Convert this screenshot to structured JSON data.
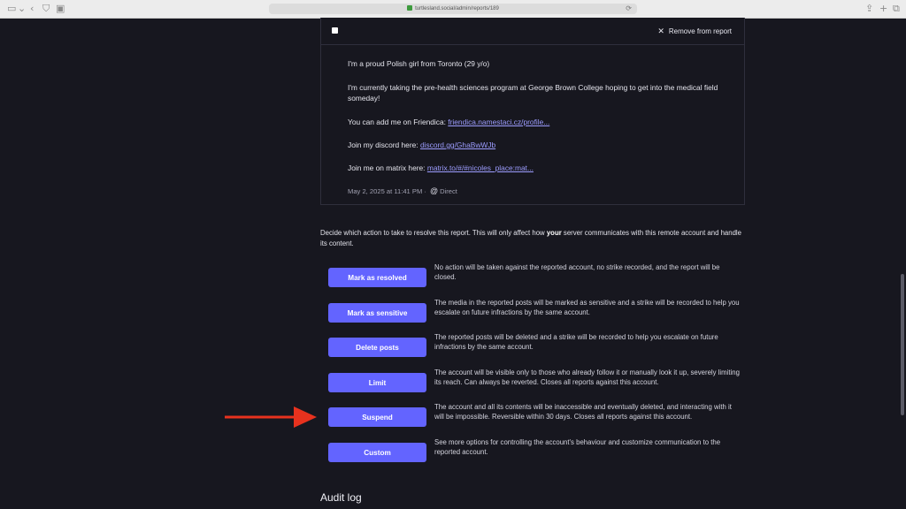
{
  "browser": {
    "url": "turtlesland.social/admin/reports/189"
  },
  "card": {
    "remove_label": "Remove from report",
    "bio_line1": "I'm a proud Polish girl from Toronto (29 y/o)",
    "bio_line2": "I'm currently taking the pre-health sciences program at George Brown College hoping to get into the medical field someday!",
    "friendica_prefix": "You can add me on Friendica: ",
    "friendica_link": "friendica.namestaci.cz/profile...",
    "discord_prefix": "Join my discord here: ",
    "discord_link": "discord.gg/GhaBwWJb",
    "matrix_prefix": "Join me on matrix here: ",
    "matrix_link": "matrix.to/#/#nicoles_place:mat...",
    "timestamp": "May 2, 2025 at 11:41 PM",
    "visibility": "Direct"
  },
  "intro": {
    "part1": "Decide which action to take to resolve this report. This will only affect how ",
    "bold": "your",
    "part2": " server communicates with this remote account and handle its content."
  },
  "actions": [
    {
      "label": "Mark as resolved",
      "desc": "No action will be taken against the reported account, no strike recorded, and the report will be closed."
    },
    {
      "label": "Mark as sensitive",
      "desc": "The media in the reported posts will be marked as sensitive and a strike will be recorded to help you escalate on future infractions by the same account."
    },
    {
      "label": "Delete posts",
      "desc": "The reported posts will be deleted and a strike will be recorded to help you escalate on future infractions by the same account."
    },
    {
      "label": "Limit",
      "desc": "The account will be visible only to those who already follow it or manually look it up, severely limiting its reach. Can always be reverted. Closes all reports against this account."
    },
    {
      "label": "Suspend",
      "desc": "The account and all its contents will be inaccessible and eventually deleted, and interacting with it will be impossible. Reversible within 30 days. Closes all reports against this account."
    },
    {
      "label": "Custom",
      "desc": "See more options for controlling the account's behaviour and customize communication to the reported account."
    }
  ],
  "audit": {
    "title": "Audit log"
  },
  "colors": {
    "background": "#17171f",
    "accent": "#6364ff",
    "link": "#9d9dff",
    "arrow": "#e8321e"
  }
}
